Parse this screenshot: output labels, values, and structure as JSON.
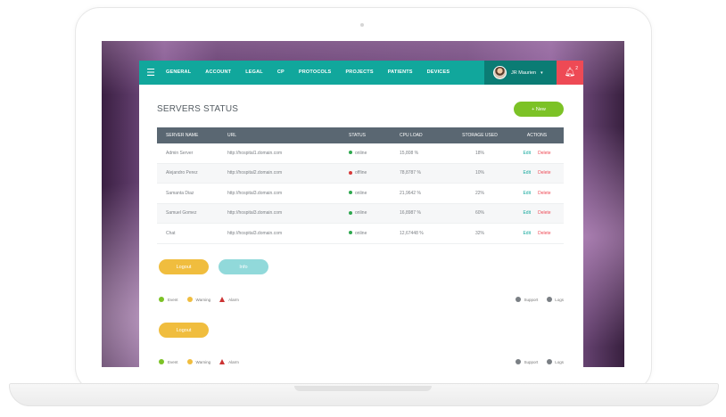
{
  "navbar": {
    "menu_icon": "hamburger-icon",
    "items": [
      "GENERAL",
      "ACCOUNT",
      "LEGAL",
      "CP",
      "PROTOCOLS",
      "PROJECTS",
      "PATIENTS",
      "DEVICES"
    ],
    "user_name": "JR Maurien",
    "caret_glyph": "▾",
    "alert_icon": "bell-icon",
    "alert_count": "2"
  },
  "page": {
    "title": "SERVERS STATUS",
    "new_button": "+ New"
  },
  "table": {
    "headers": {
      "name": "SERVER NAME",
      "url": "URL",
      "status": "STATUS",
      "cpu": "CPU LOAD",
      "storage": "STORAGE USED",
      "actions": "ACTIONS"
    },
    "rows": [
      {
        "name": "Admin Server",
        "url": "http://hospital1.domain.com",
        "status": "online",
        "cpu": "15,808 %",
        "storage": "18%",
        "edit": "Edit",
        "delete": "Delete"
      },
      {
        "name": "Alejandro Perez",
        "url": "http://hospital2.domain.com",
        "status": "offline",
        "cpu": "78,8787 %",
        "storage": "10%",
        "edit": "Edit",
        "delete": "Delete"
      },
      {
        "name": "Samanta Diaz",
        "url": "http://hospital3.domain.com",
        "status": "online",
        "cpu": "21,9642 %",
        "storage": "22%",
        "edit": "Edit",
        "delete": "Delete"
      },
      {
        "name": "Samuel Gomez",
        "url": "http://hospital3.domain.com",
        "status": "online",
        "cpu": "16,8987 %",
        "storage": "60%",
        "edit": "Edit",
        "delete": "Delete"
      },
      {
        "name": "Chat",
        "url": "http://hospital3.domain.com",
        "status": "online",
        "cpu": "12,67448 %",
        "storage": "32%",
        "edit": "Edit",
        "delete": "Delete"
      }
    ]
  },
  "buttons": {
    "logout": "Logout",
    "info": "Info",
    "logout2": "Logout"
  },
  "legend": {
    "event": "Event",
    "warning": "Warning",
    "alarm": "Alarm"
  },
  "footer": {
    "support": "Support",
    "logs": "Logs"
  },
  "colors": {
    "teal": "#11a79c",
    "teal_dark": "#0b7c74",
    "alert_red": "#ee4a55",
    "green": "#7cc226",
    "yellow": "#f0bd3e",
    "info_blue": "#91d9da",
    "online_green": "#2fa84f",
    "offline_red": "#d83b3b",
    "table_header": "#5a6772"
  }
}
